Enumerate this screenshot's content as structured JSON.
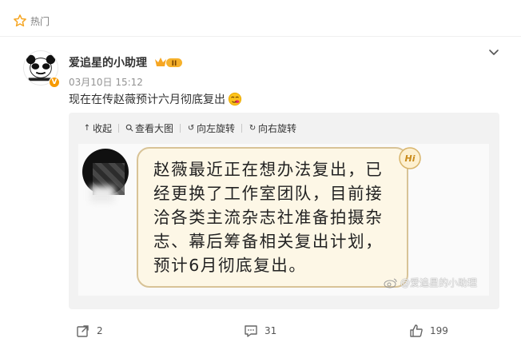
{
  "header": {
    "hot_label": "热门"
  },
  "post": {
    "author": "爱追星的小助理",
    "level_badge": "II",
    "verified_badge": "V",
    "time": "03月10日 15:12",
    "text": "现在在传赵薇预计六月彻底复出",
    "text_emoji": "face-icon"
  },
  "media_toolbar": {
    "collapse": "收起",
    "view_large": "查看大图",
    "rotate_left": "向左旋转",
    "rotate_right": "向右旋转"
  },
  "image": {
    "bubble_badge": "Hi",
    "bubble_lines": [
      "赵薇最近正在想办法复出，已",
      "经更换了工作室团队，目前接",
      "洽各类主流杂志社准备拍摄杂",
      "志、幕后筹备相关复出计划，",
      "预计6月彻底复出。"
    ],
    "watermark": "@爱追星的小助理"
  },
  "actions": {
    "repost_count": "2",
    "comment_count": "31",
    "like_count": "199"
  },
  "colors": {
    "accent": "#f79a00",
    "bubble_bg": "#fdf7e6",
    "bubble_border": "#d8c397",
    "muted": "#939393"
  }
}
